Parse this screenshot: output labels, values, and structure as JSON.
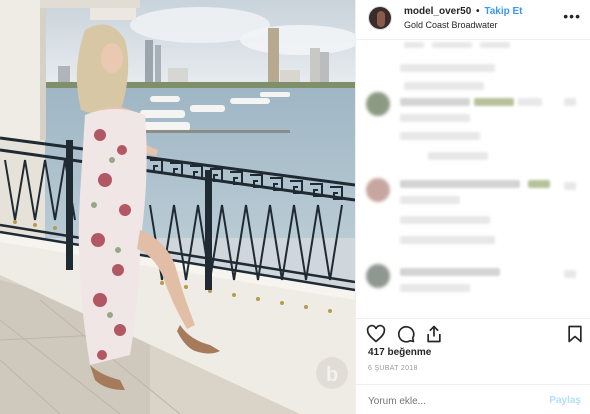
{
  "post": {
    "username": "model_over50",
    "separator": "•",
    "follow_label": "Takip Et",
    "location": "Gold Coast Broadwater",
    "more_icon": "more-dots-icon"
  },
  "actions": {
    "icons": [
      "heart-icon",
      "comment-icon",
      "share-icon",
      "bookmark-icon"
    ]
  },
  "likes_text": "417 beğenme",
  "date_text": "6 ŞUBAT 2018",
  "comment_box": {
    "placeholder": "Yorum ekle...",
    "post_label": "Paylaş"
  },
  "colors": {
    "follow_blue": "#3897f0",
    "post_disabled": "#b2dffc",
    "text": "#262626",
    "muted": "#999999"
  }
}
